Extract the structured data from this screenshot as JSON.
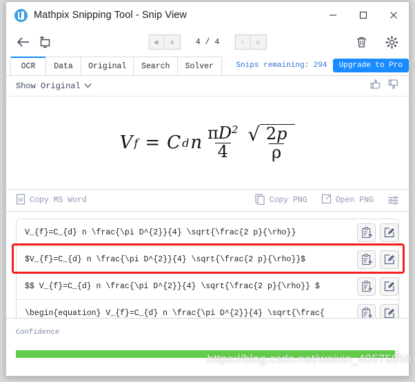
{
  "window": {
    "title": "Mathpix Snipping Tool - Snip View",
    "logo_icon": "mathpix-logo-icon",
    "minimize_label": "─",
    "maximize_label": "□",
    "close_label": "✕"
  },
  "navbar": {
    "back_icon": "back-arrow-icon",
    "new_snip_icon": "new-snip-icon",
    "first_page_label": "«",
    "prev_page_label": "‹",
    "page_indicator": "4 / 4",
    "next_page_label": "›",
    "last_page_label": "»",
    "delete_icon": "trash-icon",
    "settings_icon": "gear-icon"
  },
  "tabs": [
    {
      "label": "OCR",
      "active": true
    },
    {
      "label": "Data",
      "active": false
    },
    {
      "label": "Original",
      "active": false
    },
    {
      "label": "Search",
      "active": false
    },
    {
      "label": "Solver",
      "active": false
    }
  ],
  "status": {
    "snips_remaining": "Snips remaining: 294",
    "upgrade_label": "Upgrade to Pro",
    "accent_color": "#1a8cff"
  },
  "show_row": {
    "dropdown_label": "Show Original",
    "chevron_icon": "chevron-down-icon",
    "thumbs_up_icon": "thumbs-up-icon",
    "thumbs_down_icon": "thumbs-down-icon"
  },
  "formula": {
    "lhs_var": "V",
    "lhs_sub": "f",
    "equals": "=",
    "cd_var": "C",
    "cd_sub": "d",
    "n_var": "n",
    "frac_num_pi": "π",
    "frac_num_D": "D",
    "frac_num_exp": "2",
    "frac_den": "4",
    "radical": "√",
    "sqrt_num": "2",
    "sqrt_num_var": "p",
    "sqrt_den": "ρ"
  },
  "copybar": {
    "word_icon": "word-document-icon",
    "copy_word_label": "Copy MS Word",
    "png_icon": "copy-png-icon",
    "copy_png_label": "Copy PNG",
    "open_icon": "open-external-icon",
    "open_png_label": "Open PNG",
    "sliders_icon": "sliders-settings-icon"
  },
  "results": {
    "copy_icon": "clipboard-copy-icon",
    "edit_icon": "edit-pencil-icon",
    "highlighted_index": 1,
    "rows": [
      {
        "latex": "V_{f}=C_{d}  n \\frac{\\pi D^{2}}{4}  \\sqrt{\\frac{2 p}{\\rho}}"
      },
      {
        "latex": "$V_{f}=C_{d}  n \\frac{\\pi D^{2}}{4}  \\sqrt{\\frac{2 p}{\\rho}}$"
      },
      {
        "latex": "$$  V_{f}=C_{d}  n \\frac{\\pi D^{2}}{4}  \\sqrt{\\frac{2 p}{\\rho}}  $"
      },
      {
        "latex": "\\begin{equation}  V_{f}=C_{d}  n \\frac{\\pi D^{2}}{4}  \\sqrt{\\frac{"
      }
    ]
  },
  "confidence": {
    "label": "Confidence",
    "percent": 99,
    "bar_color": "#63cb4a"
  },
  "watermark": {
    "text": "https://blog.csdn.net/weixin_40575956"
  }
}
